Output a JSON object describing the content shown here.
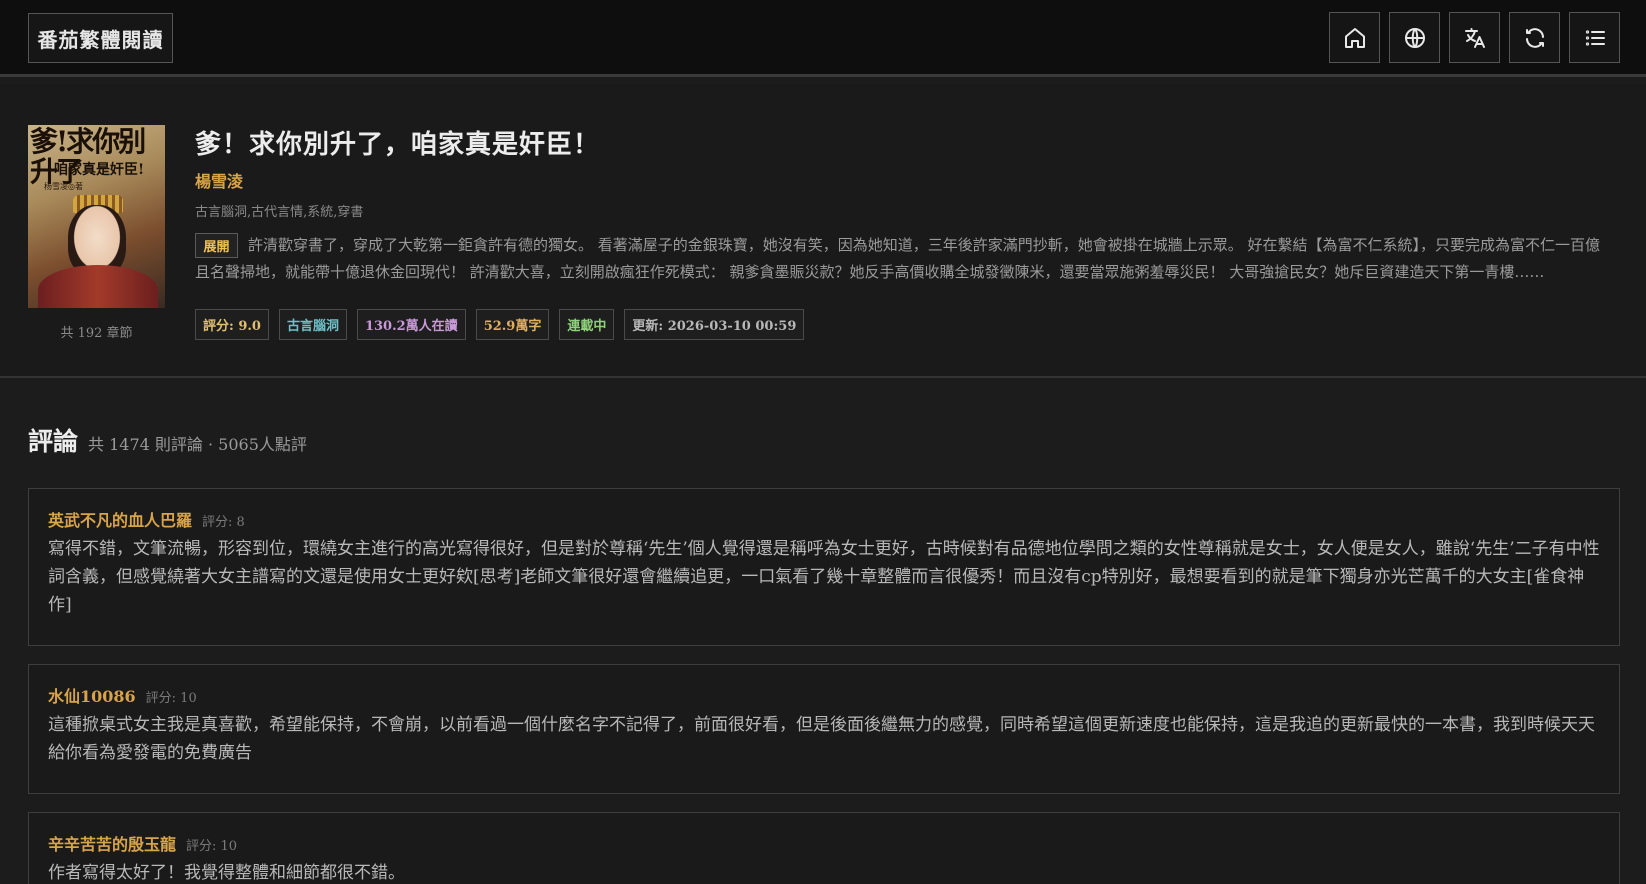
{
  "header": {
    "logo": "番茄繁體閱讀",
    "buttons": [
      {
        "name": "home-icon"
      },
      {
        "name": "globe-icon"
      },
      {
        "name": "translate-icon"
      },
      {
        "name": "refresh-icon"
      },
      {
        "name": "list-icon"
      }
    ]
  },
  "book": {
    "cover_title": "爹!求你别升了",
    "cover_subtitle": "咱家真是奸臣!",
    "cover_author": "杨雪凌◎著",
    "chapters": "共 192 章節",
    "title": "爹！求你別升了，咱家真是奸臣！",
    "author": "楊雪淩",
    "genres": "古言腦洞,古代言情,系統,穿書",
    "expand_label": "展開",
    "synopsis": "許清歡穿書了，穿成了大乾第一鉅貪許有德的獨女。 看著滿屋子的金銀珠寶，她沒有笑，因為她知道，三年後許家滿門抄斬，她會被掛在城牆上示眾。 好在繫結【為富不仁系統】，只要完成為富不仁一百億且名聲掃地，就能帶十億退休金回現代！ 許清歡大喜，立刻開啟瘋狂作死模式： 親爹貪墨賑災款？她反手高價收購全城發黴陳米，還要當眾施粥羞辱災民！ 大哥強搶民女？她斥巨資建造天下第一青樓……",
    "tags": [
      {
        "label": "評分: 9.0",
        "color": "#e0c070"
      },
      {
        "label": "古言腦洞",
        "color": "#6ec0c8"
      },
      {
        "label": "130.2萬人在讀",
        "color": "#c89ad8"
      },
      {
        "label": "52.9萬字",
        "color": "#e0b060"
      },
      {
        "label": "連載中",
        "color": "#8fd07a"
      },
      {
        "label": "更新: 2026-03-10 00:59",
        "color": "#b8b8b8"
      }
    ]
  },
  "comments": {
    "heading": "評論",
    "summary": "共 1474 則評論 · 5065人點評",
    "items": [
      {
        "user": "英武不凡的血人巴羅",
        "score": "評分: 8",
        "text": "寫得不錯，文筆流暢，形容到位，環繞女主進行的高光寫得很好，但是對於尊稱‘先生’個人覺得還是稱呼為女士更好，古時候對有品德地位學問之類的女性尊稱就是女士，女人便是女人，雖說‘先生’二子有中性詞含義，但感覺繞著大女主譜寫的文還是使用女士更好欸[思考]老師文筆很好還會繼續追更，一口氣看了幾十章整體而言很優秀！而且沒有cp特別好，最想要看到的就是筆下獨身亦光芒萬千的大女主[雀食神作]"
      },
      {
        "user": "水仙10086",
        "score": "評分: 10",
        "text": "這種掀桌式女主我是真喜歡，希望能保持，不會崩，以前看過一個什麼名字不記得了，前面很好看，但是後面後繼無力的感覺，同時希望這個更新速度也能保持，這是我追的更新最快的一本書，我到時候天天給你看為愛發電的免費廣告"
      },
      {
        "user": "辛辛苦苦的殷玉龍",
        "score": "評分: 10",
        "text": "作者寫得太好了！我覺得整體和細節都很不錯。"
      }
    ]
  }
}
